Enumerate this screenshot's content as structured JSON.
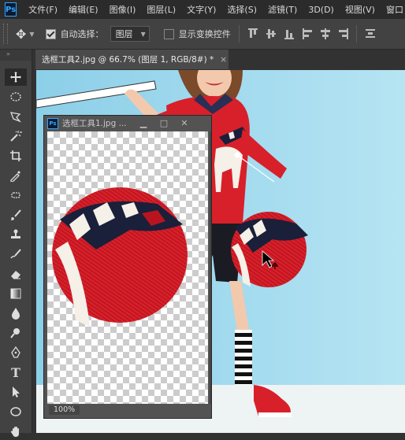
{
  "menubar": {
    "logo": "Ps",
    "items": [
      "文件(F)",
      "编辑(E)",
      "图像(I)",
      "图层(L)",
      "文字(Y)",
      "选择(S)",
      "滤镜(T)",
      "3D(D)",
      "视图(V)",
      "窗口"
    ]
  },
  "options": {
    "auto_select_label": "自动选择：",
    "auto_select_checked": true,
    "auto_select_target": "图层",
    "show_transform_label": "显示变换控件",
    "show_transform_checked": false
  },
  "tools": {
    "header": "»",
    "items": [
      "move",
      "marquee-ellipse",
      "lasso-polygon",
      "magic-wand",
      "crop",
      "eyedropper",
      "healing",
      "brush",
      "stamp",
      "history-brush",
      "eraser",
      "gradient",
      "blur",
      "dodge",
      "pen",
      "type",
      "path-select",
      "shape-ellipse",
      "hand"
    ],
    "type_label": "T"
  },
  "document": {
    "tab_title": "选框工具2.jpg @ 66.7% (图层 1, RGB/8#) *",
    "close": "×"
  },
  "float_window": {
    "logo": "Ps",
    "title": "选框工具1.jpg ...",
    "zoom": "100%",
    "minimize": "▁",
    "maximize": "□",
    "close": "✕"
  },
  "colors": {
    "panel": "#424242",
    "menubar": "#2b2b2b",
    "background": "#9fd7ec",
    "sweater_red": "#d8202a",
    "navy": "#1a1f3a",
    "accent_blue": "#31a8ff"
  }
}
